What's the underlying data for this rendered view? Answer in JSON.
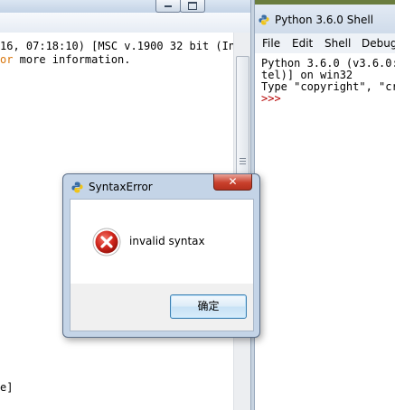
{
  "left_window": {
    "console_lines": [
      {
        "text": "16, 07:18:10) [MSC v.1900 32 bit (In"
      },
      {
        "prefix": "or",
        "text": " more information."
      }
    ],
    "last_line_fragment": "e]"
  },
  "right_window": {
    "title": "Python 3.6.0 Shell",
    "menu": [
      "File",
      "Edit",
      "Shell",
      "Debug"
    ],
    "shell_lines": [
      "Python 3.6.0 (v3.6.0:",
      "tel)] on win32",
      "Type \"copyright\", \"cr"
    ],
    "prompt": ">>>"
  },
  "dialog": {
    "title": "SyntaxError",
    "message": "invalid syntax",
    "ok_label": "确定",
    "close_glyph": "✕"
  },
  "colors": {
    "error_red": "#c9241f",
    "accent_blue": "#3c7fb1",
    "prompt_red": "#b50000",
    "keyword_orange": "#d8750b"
  }
}
